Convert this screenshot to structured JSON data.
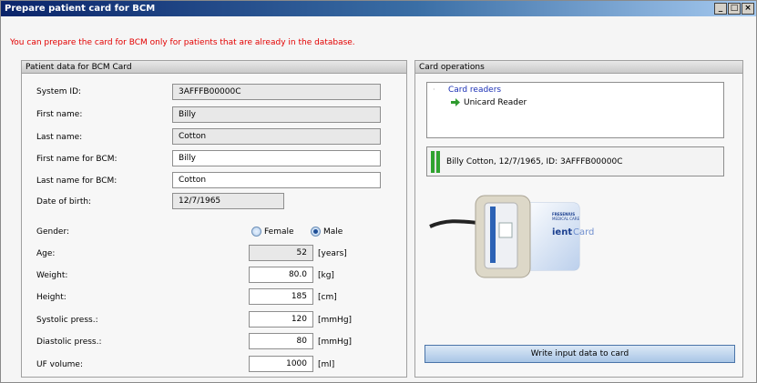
{
  "window": {
    "title": "Prepare patient card for BCM",
    "controls": [
      "_",
      "□",
      "×"
    ]
  },
  "notice": "You can prepare the card for BCM only for patients that are already in the database.",
  "left_panel": {
    "title": "Patient data for BCM Card",
    "fields": {
      "system_id": {
        "label": "System ID:",
        "value": "3AFFFB00000C"
      },
      "first_name": {
        "label": "First name:",
        "value": "Billy"
      },
      "last_name": {
        "label": "Last name:",
        "value": "Cotton"
      },
      "first_name_bcm": {
        "label": "First name for BCM:",
        "value": "Billy"
      },
      "last_name_bcm": {
        "label": "Last name for BCM:",
        "value": "Cotton"
      },
      "dob": {
        "label": "Date of birth:",
        "value": "12/7/1965"
      }
    },
    "gender": {
      "label": "Gender:",
      "female": "Female",
      "male": "Male",
      "selected": "Male"
    },
    "measures": {
      "age": {
        "label": "Age:",
        "value": "52",
        "unit": "[years]"
      },
      "weight": {
        "label": "Weight:",
        "value": "80.0",
        "unit": "[kg]"
      },
      "height": {
        "label": "Height:",
        "value": "185",
        "unit": "[cm]"
      },
      "systolic": {
        "label": "Systolic press.:",
        "value": "120",
        "unit": "[mmHg]"
      },
      "diastolic": {
        "label": "Diastolic press.:",
        "value": "80",
        "unit": "[mmHg]"
      },
      "uf": {
        "label": "UF volume:",
        "value": "1000",
        "unit": "[ml]"
      }
    }
  },
  "right_panel": {
    "title": "Card operations",
    "tree": {
      "root": "Card readers",
      "child": "Unicard Reader"
    },
    "status": "Billy Cotton, 12/7/1965, ID: 3AFFFB00000C",
    "card_image": {
      "brand_line1": "FRESENIUS",
      "brand_line2": "MEDICAL CARE",
      "card_text_bold": "ient",
      "card_text_light": "Card"
    },
    "write_button": "Write input data to card"
  },
  "colors": {
    "accent": "#0a246a",
    "notice": "#e30000",
    "status_green": "#2fa32f"
  }
}
